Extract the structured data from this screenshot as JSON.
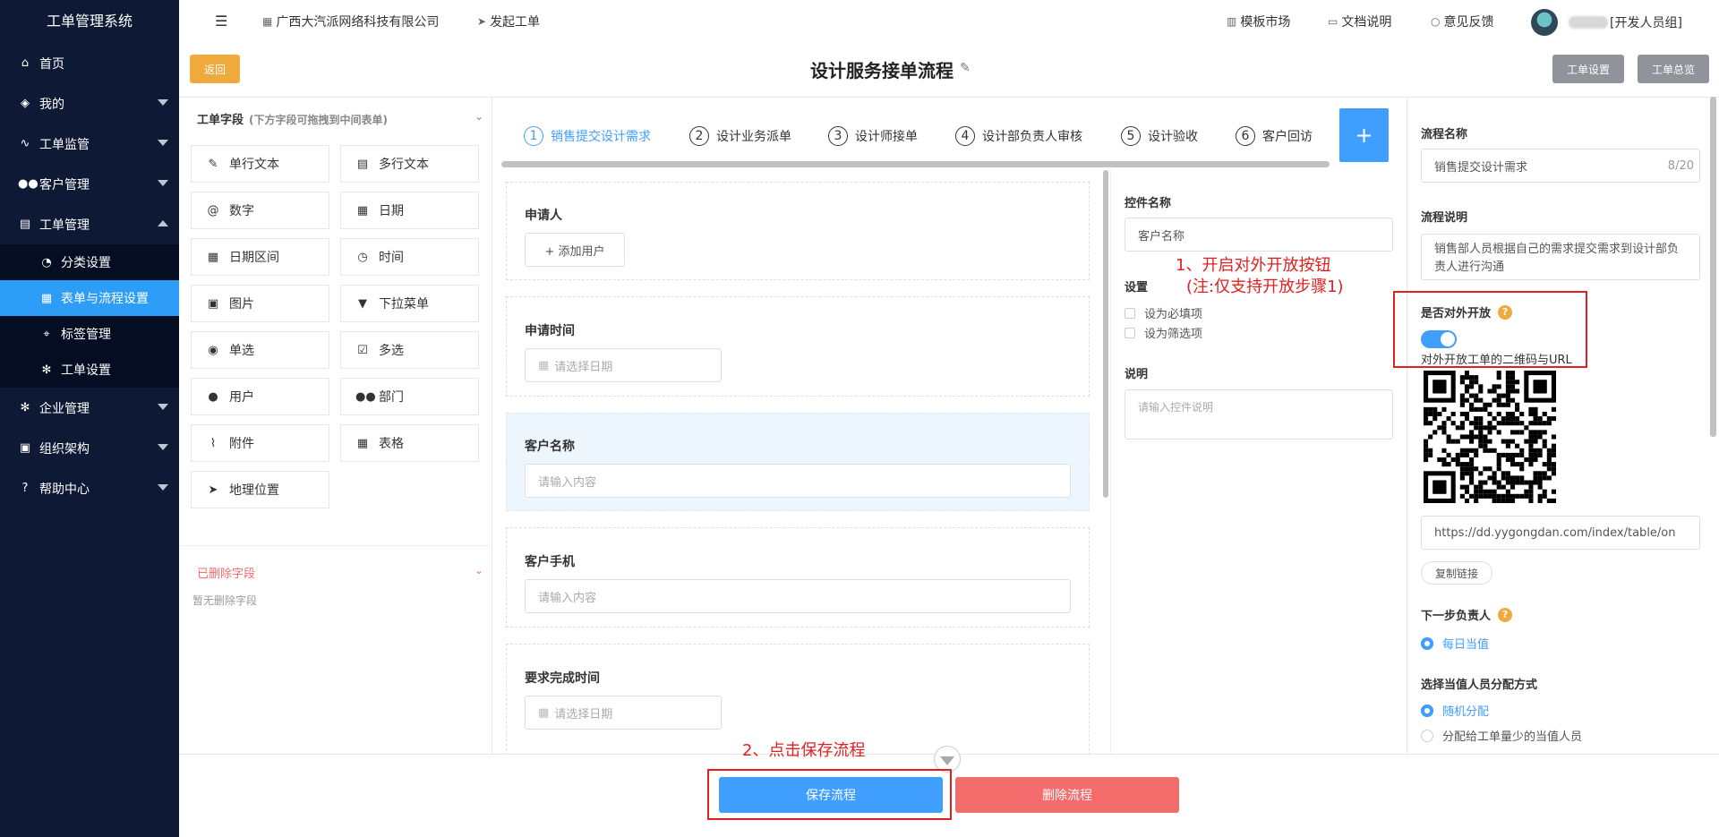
{
  "sidebar": {
    "title": "工单管理系统",
    "items": [
      {
        "label": "首页",
        "icon": "home-icon"
      },
      {
        "label": "我的",
        "icon": "layers-icon"
      },
      {
        "label": "工单监管",
        "icon": "pulse-icon"
      },
      {
        "label": "客户管理",
        "icon": "users-icon"
      },
      {
        "label": "工单管理",
        "icon": "clipboard-icon"
      },
      {
        "label": "企业管理",
        "icon": "gear-icon"
      },
      {
        "label": "组织架构",
        "icon": "org-icon"
      },
      {
        "label": "帮助中心",
        "icon": "question-icon"
      }
    ],
    "subitems": [
      {
        "label": "分类设置"
      },
      {
        "label": "表单与流程设置"
      },
      {
        "label": "标签管理"
      },
      {
        "label": "工单设置"
      }
    ]
  },
  "topbar": {
    "company": "广西大汽派网络科技有限公司",
    "start_ticket": "发起工单",
    "template_market": "模板市场",
    "docs": "文档说明",
    "feedback": "意见反馈",
    "user_group": "[开发人员组]"
  },
  "titlebar": {
    "back": "返回",
    "title": "设计服务接单流程",
    "ticket_settings": "工单设置",
    "ticket_overview": "工单总览"
  },
  "palette": {
    "header": "工单字段",
    "hint": "(下方字段可拖拽到中间表单)",
    "fields": [
      "单行文本",
      "多行文本",
      "数字",
      "日期",
      "日期区间",
      "时间",
      "图片",
      "下拉菜单",
      "单选",
      "多选",
      "用户",
      "部门",
      "附件",
      "表格",
      "地理位置"
    ],
    "deleted_title": "已删除字段",
    "deleted_empty": "暂无删除字段"
  },
  "steps": [
    {
      "num": "1",
      "label": "销售提交设计需求"
    },
    {
      "num": "2",
      "label": "设计业务派单"
    },
    {
      "num": "3",
      "label": "设计师接单"
    },
    {
      "num": "4",
      "label": "设计部负责人审核"
    },
    {
      "num": "5",
      "label": "设计验收"
    },
    {
      "num": "6",
      "label": "客户回访"
    }
  ],
  "steps_add": "+",
  "form": {
    "applicant_label": "申请人",
    "add_user": "+ 添加用户",
    "apply_time_label": "申请时间",
    "date_placeholder": "请选择日期",
    "customer_name_label": "客户名称",
    "input_placeholder": "请输入内容",
    "customer_phone_label": "客户手机",
    "deadline_label": "要求完成时间"
  },
  "props": {
    "name_label": "控件名称",
    "name_value": "客户名称",
    "settings_label": "设置",
    "required": "设为必填项",
    "filter": "设为筛选项",
    "desc_label": "说明",
    "desc_placeholder": "请输入控件说明"
  },
  "process": {
    "name_label": "流程名称",
    "name_value": "销售提交设计需求",
    "name_count": "8/20",
    "desc_label": "流程说明",
    "desc_value": "销售部人员根据自己的需求提交需求到设计部负责人进行沟通",
    "public_label": "是否对外开放",
    "public_on": true,
    "url_caption": "对外开放工单的二维码与URL",
    "url": "https://dd.yygongdan.com/index/table/on",
    "copy": "复制链接",
    "next_label": "下一步负责人",
    "next_option": "每日当值",
    "assign_label": "选择当值人员分配方式",
    "assign_opt1": "随机分配",
    "assign_opt2": "分配给工单量少的当值人员"
  },
  "bottom": {
    "save": "保存流程",
    "delete": "删除流程"
  },
  "annotations": {
    "note1_line1": "1、开启对外开放按钮",
    "note1_line2": "(注:仅支持开放步骤1)",
    "note2": "2、点击保存流程"
  },
  "colors": {
    "sidebar_bg": "#0e1a35",
    "sidebar_active": "#2e9df7",
    "primary": "#409eff",
    "danger": "#f56c6c",
    "warning": "#f0a93d",
    "annotation": "#e02020"
  }
}
